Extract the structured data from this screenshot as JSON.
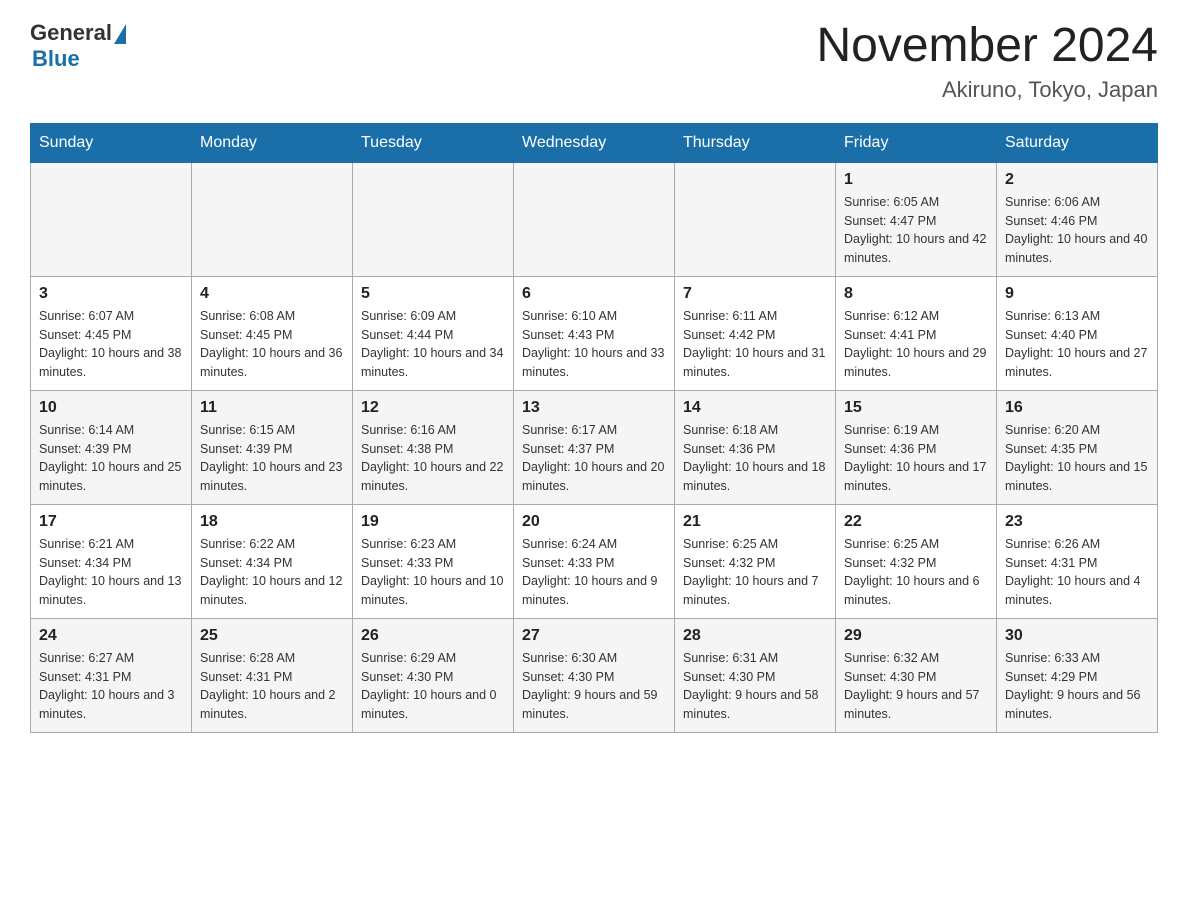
{
  "header": {
    "logo": {
      "general": "General",
      "blue": "Blue"
    },
    "title": "November 2024",
    "location": "Akiruno, Tokyo, Japan"
  },
  "calendar": {
    "days_of_week": [
      "Sunday",
      "Monday",
      "Tuesday",
      "Wednesday",
      "Thursday",
      "Friday",
      "Saturday"
    ],
    "weeks": [
      [
        {
          "day": "",
          "info": ""
        },
        {
          "day": "",
          "info": ""
        },
        {
          "day": "",
          "info": ""
        },
        {
          "day": "",
          "info": ""
        },
        {
          "day": "",
          "info": ""
        },
        {
          "day": "1",
          "info": "Sunrise: 6:05 AM\nSunset: 4:47 PM\nDaylight: 10 hours and 42 minutes."
        },
        {
          "day": "2",
          "info": "Sunrise: 6:06 AM\nSunset: 4:46 PM\nDaylight: 10 hours and 40 minutes."
        }
      ],
      [
        {
          "day": "3",
          "info": "Sunrise: 6:07 AM\nSunset: 4:45 PM\nDaylight: 10 hours and 38 minutes."
        },
        {
          "day": "4",
          "info": "Sunrise: 6:08 AM\nSunset: 4:45 PM\nDaylight: 10 hours and 36 minutes."
        },
        {
          "day": "5",
          "info": "Sunrise: 6:09 AM\nSunset: 4:44 PM\nDaylight: 10 hours and 34 minutes."
        },
        {
          "day": "6",
          "info": "Sunrise: 6:10 AM\nSunset: 4:43 PM\nDaylight: 10 hours and 33 minutes."
        },
        {
          "day": "7",
          "info": "Sunrise: 6:11 AM\nSunset: 4:42 PM\nDaylight: 10 hours and 31 minutes."
        },
        {
          "day": "8",
          "info": "Sunrise: 6:12 AM\nSunset: 4:41 PM\nDaylight: 10 hours and 29 minutes."
        },
        {
          "day": "9",
          "info": "Sunrise: 6:13 AM\nSunset: 4:40 PM\nDaylight: 10 hours and 27 minutes."
        }
      ],
      [
        {
          "day": "10",
          "info": "Sunrise: 6:14 AM\nSunset: 4:39 PM\nDaylight: 10 hours and 25 minutes."
        },
        {
          "day": "11",
          "info": "Sunrise: 6:15 AM\nSunset: 4:39 PM\nDaylight: 10 hours and 23 minutes."
        },
        {
          "day": "12",
          "info": "Sunrise: 6:16 AM\nSunset: 4:38 PM\nDaylight: 10 hours and 22 minutes."
        },
        {
          "day": "13",
          "info": "Sunrise: 6:17 AM\nSunset: 4:37 PM\nDaylight: 10 hours and 20 minutes."
        },
        {
          "day": "14",
          "info": "Sunrise: 6:18 AM\nSunset: 4:36 PM\nDaylight: 10 hours and 18 minutes."
        },
        {
          "day": "15",
          "info": "Sunrise: 6:19 AM\nSunset: 4:36 PM\nDaylight: 10 hours and 17 minutes."
        },
        {
          "day": "16",
          "info": "Sunrise: 6:20 AM\nSunset: 4:35 PM\nDaylight: 10 hours and 15 minutes."
        }
      ],
      [
        {
          "day": "17",
          "info": "Sunrise: 6:21 AM\nSunset: 4:34 PM\nDaylight: 10 hours and 13 minutes."
        },
        {
          "day": "18",
          "info": "Sunrise: 6:22 AM\nSunset: 4:34 PM\nDaylight: 10 hours and 12 minutes."
        },
        {
          "day": "19",
          "info": "Sunrise: 6:23 AM\nSunset: 4:33 PM\nDaylight: 10 hours and 10 minutes."
        },
        {
          "day": "20",
          "info": "Sunrise: 6:24 AM\nSunset: 4:33 PM\nDaylight: 10 hours and 9 minutes."
        },
        {
          "day": "21",
          "info": "Sunrise: 6:25 AM\nSunset: 4:32 PM\nDaylight: 10 hours and 7 minutes."
        },
        {
          "day": "22",
          "info": "Sunrise: 6:25 AM\nSunset: 4:32 PM\nDaylight: 10 hours and 6 minutes."
        },
        {
          "day": "23",
          "info": "Sunrise: 6:26 AM\nSunset: 4:31 PM\nDaylight: 10 hours and 4 minutes."
        }
      ],
      [
        {
          "day": "24",
          "info": "Sunrise: 6:27 AM\nSunset: 4:31 PM\nDaylight: 10 hours and 3 minutes."
        },
        {
          "day": "25",
          "info": "Sunrise: 6:28 AM\nSunset: 4:31 PM\nDaylight: 10 hours and 2 minutes."
        },
        {
          "day": "26",
          "info": "Sunrise: 6:29 AM\nSunset: 4:30 PM\nDaylight: 10 hours and 0 minutes."
        },
        {
          "day": "27",
          "info": "Sunrise: 6:30 AM\nSunset: 4:30 PM\nDaylight: 9 hours and 59 minutes."
        },
        {
          "day": "28",
          "info": "Sunrise: 6:31 AM\nSunset: 4:30 PM\nDaylight: 9 hours and 58 minutes."
        },
        {
          "day": "29",
          "info": "Sunrise: 6:32 AM\nSunset: 4:30 PM\nDaylight: 9 hours and 57 minutes."
        },
        {
          "day": "30",
          "info": "Sunrise: 6:33 AM\nSunset: 4:29 PM\nDaylight: 9 hours and 56 minutes."
        }
      ]
    ]
  }
}
